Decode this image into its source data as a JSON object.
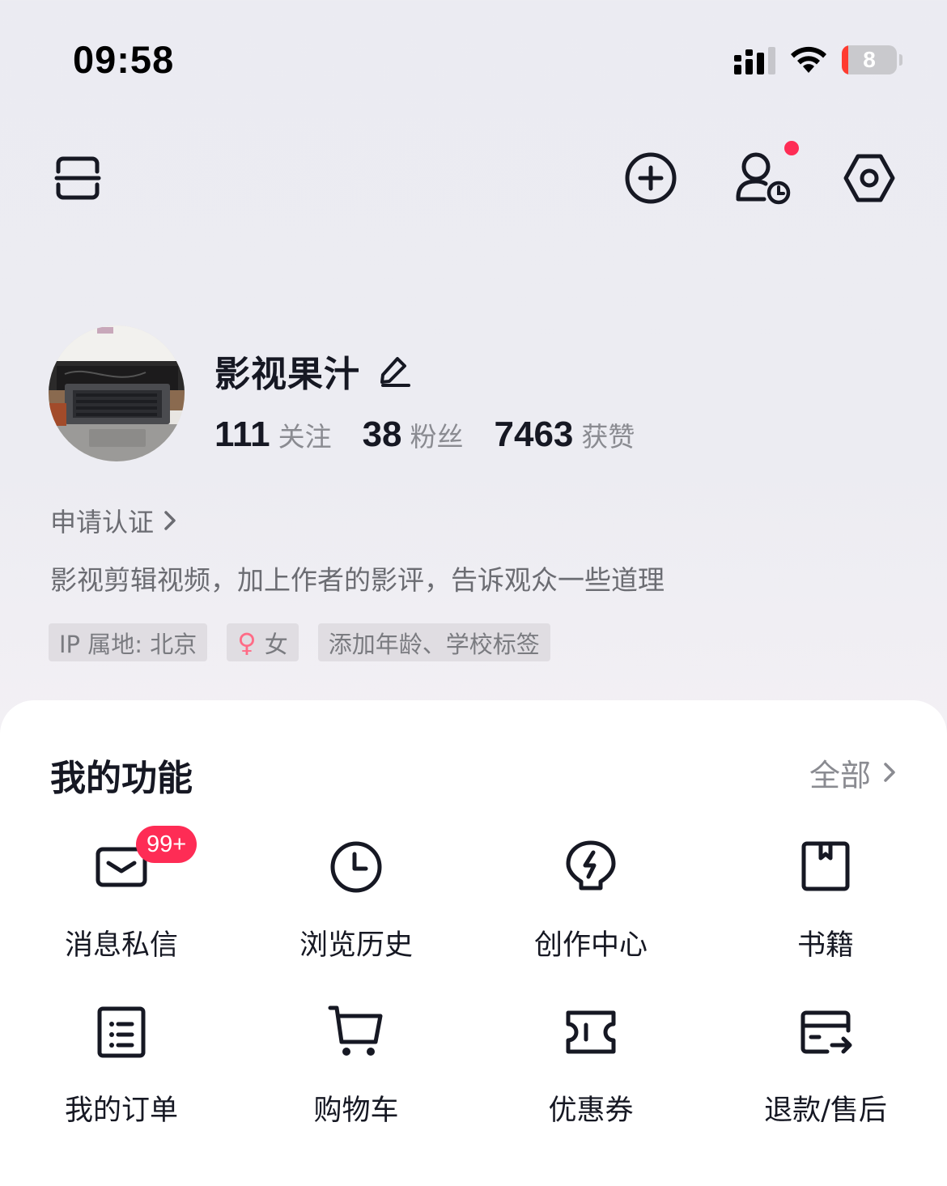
{
  "status_bar": {
    "time": "09:58",
    "battery_text": "8",
    "battery_level": 0.08,
    "icons": [
      "signal-icon",
      "wifi-icon",
      "battery-icon"
    ]
  },
  "top_bar": {
    "icons": [
      "scan-icon",
      "add-circle-icon",
      "visitor-history-icon",
      "settings-icon"
    ],
    "notification_dot_color": "#fe2c55"
  },
  "profile": {
    "nickname": "影视果汁",
    "stats": [
      {
        "number": "111",
        "label": "关注"
      },
      {
        "number": "38",
        "label": "粉丝"
      },
      {
        "number": "7463",
        "label": "获赞"
      }
    ],
    "verify_label": "申请认证",
    "bio": "影视剪辑视频，加上作者的影评，告诉观众一些道理",
    "tags": {
      "ip": "IP 属地: 北京",
      "gender_symbol": "♀",
      "gender": "女",
      "add_tags": "添加年龄、学校标签"
    }
  },
  "functions": {
    "title": "我的功能",
    "all_label": "全部",
    "items": [
      {
        "label": "消息私信",
        "icon": "mail-icon",
        "badge": "99+"
      },
      {
        "label": "浏览历史",
        "icon": "clock-icon"
      },
      {
        "label": "创作中心",
        "icon": "lightning-bulb-icon"
      },
      {
        "label": "书籍",
        "icon": "book-icon"
      },
      {
        "label": "我的订单",
        "icon": "order-list-icon"
      },
      {
        "label": "购物车",
        "icon": "cart-icon"
      },
      {
        "label": "优惠券",
        "icon": "coupon-icon"
      },
      {
        "label": "退款",
        "label_suffix": "/售后",
        "icon": "refund-card-icon"
      }
    ]
  },
  "colors": {
    "accent_red": "#fe2c55",
    "text_primary": "#161823",
    "text_secondary": "#8a8b91"
  }
}
